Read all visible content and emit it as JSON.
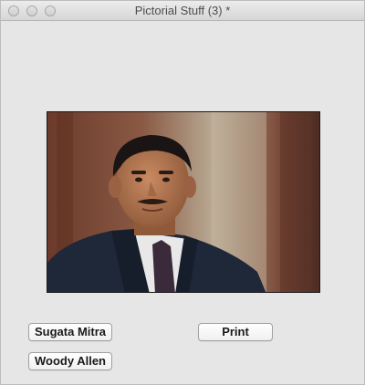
{
  "window": {
    "title": "Pictorial Stuff (3) *"
  },
  "photo": {
    "subject": "Sugata Mitra"
  },
  "buttons": {
    "sugata_label": "Sugata Mitra",
    "print_label": "Print",
    "woody_label": "Woody Allen"
  },
  "colors": {
    "window_bg": "#e6e6e6",
    "button_text": "#1a1a1a"
  }
}
